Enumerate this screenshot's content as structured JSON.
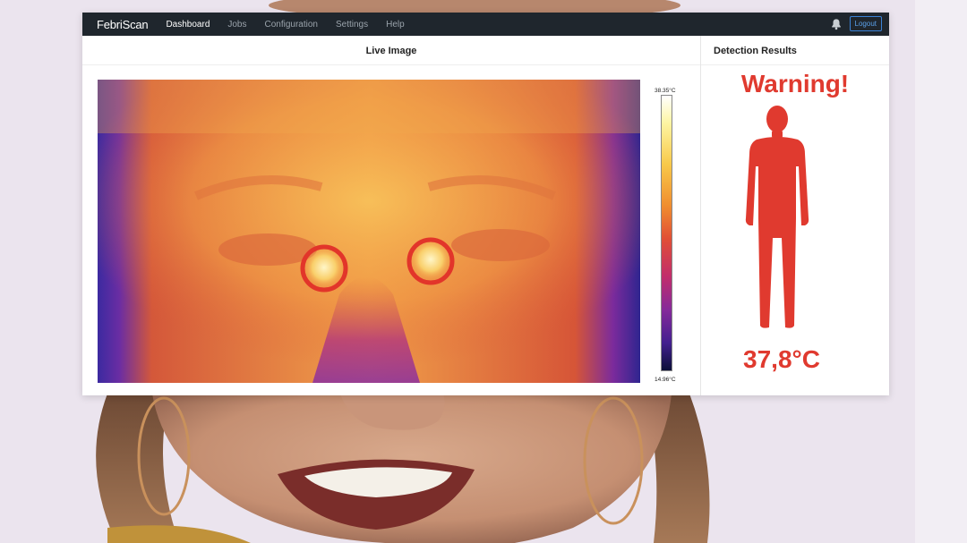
{
  "navbar": {
    "brand": "FebriScan",
    "items": [
      {
        "label": "Dashboard",
        "active": true
      },
      {
        "label": "Jobs",
        "active": false
      },
      {
        "label": "Configuration",
        "active": false
      },
      {
        "label": "Settings",
        "active": false
      },
      {
        "label": "Help",
        "active": false
      }
    ],
    "logout_label": "Logout"
  },
  "live_panel": {
    "title": "Live Image",
    "scale_max": "38.35°C",
    "scale_min": "14.96°C"
  },
  "results_panel": {
    "title": "Detection Results",
    "status": "Warning!",
    "temperature": "37,8°C"
  },
  "colors": {
    "navbar_bg": "#1f262d",
    "accent_blue": "#3b82d6",
    "warning_red": "#e03a2f"
  },
  "icons": [
    "bell-icon",
    "human-body-icon",
    "detection-ring"
  ]
}
